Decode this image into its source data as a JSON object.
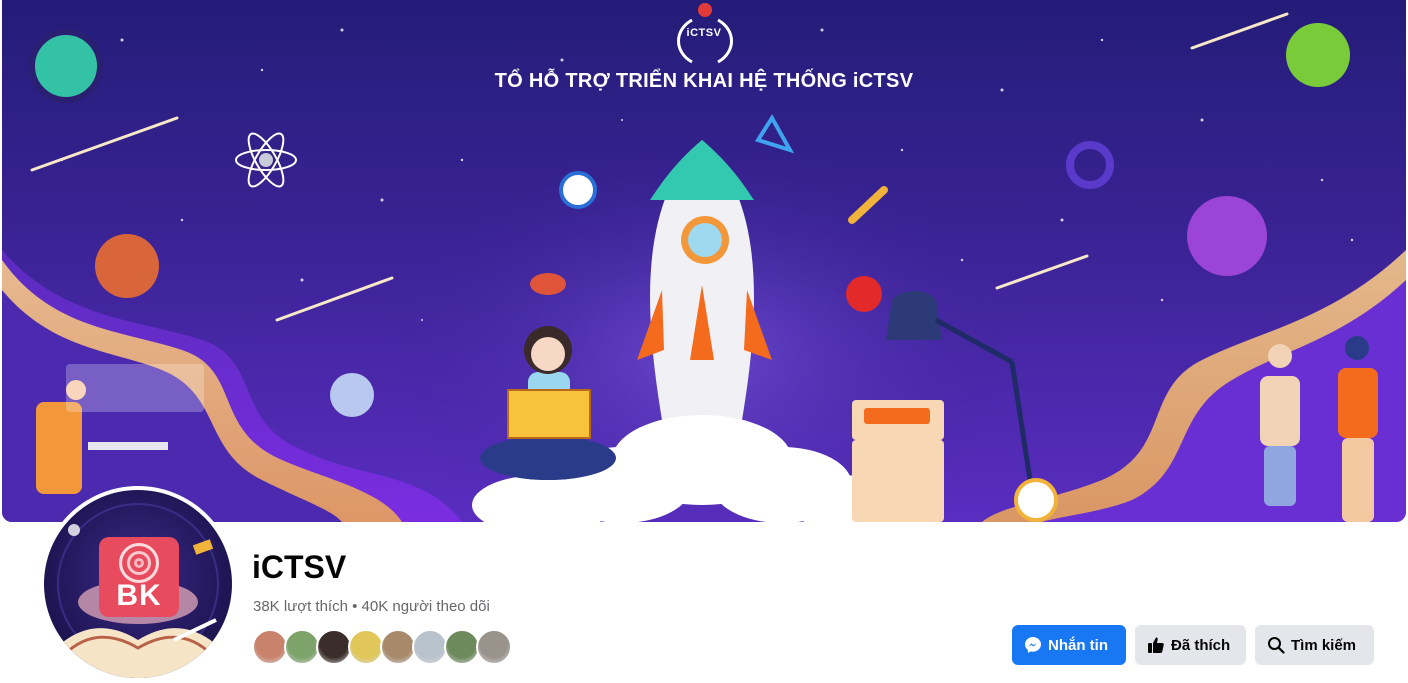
{
  "cover": {
    "logo_text": "iCTSV",
    "banner_title": "TỔ HỖ TRỢ TRIỂN KHAI HỆ THỐNG iCTSV"
  },
  "profile": {
    "avatar_text": "BK",
    "name": "iCTSV",
    "stats": "38K lượt thích • 40K người theo dõi"
  },
  "followers": [
    {
      "color": "#c9826b"
    },
    {
      "color": "#7da36a"
    },
    {
      "color": "#3b2e2a"
    },
    {
      "color": "#e1c75a"
    },
    {
      "color": "#a88a6a"
    },
    {
      "color": "#b9c3cc"
    },
    {
      "color": "#6c8a5c"
    },
    {
      "color": "#9a938c"
    }
  ],
  "actions": {
    "message_label": "Nhắn tin",
    "liked_label": "Đã thích",
    "search_label": "Tìm kiếm"
  },
  "colors": {
    "primary": "#1877f2",
    "secondary_button": "#e4e6eb",
    "cover_background": "#3a2394"
  }
}
